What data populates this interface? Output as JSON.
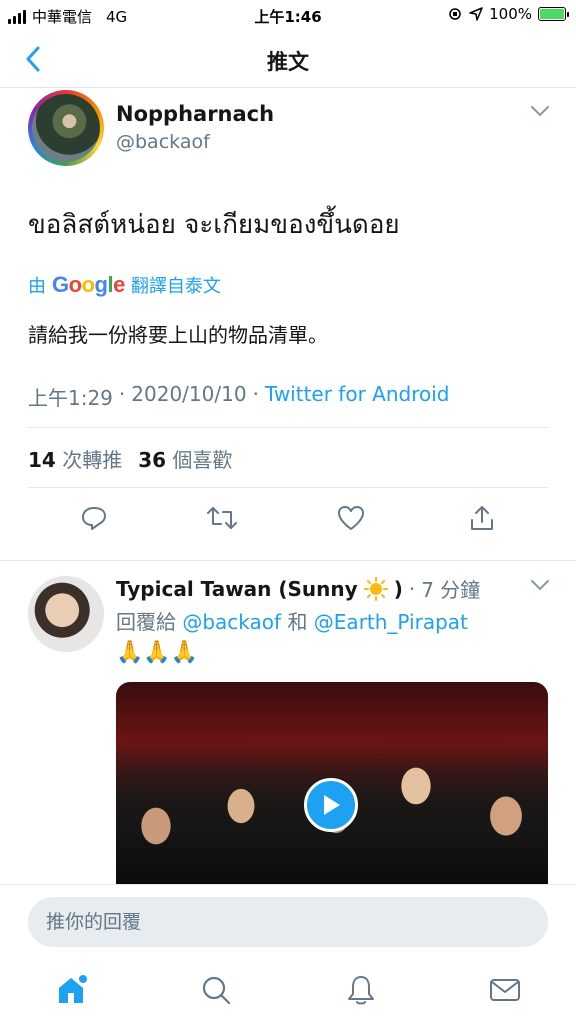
{
  "status_bar": {
    "carrier": "中華電信",
    "network": "4G",
    "time": "上午1:46",
    "battery": "100%"
  },
  "header": {
    "title": "推文"
  },
  "main_tweet": {
    "author_name": "Noppharnach",
    "author_handle": "@backaof",
    "text": "ขอลิสต์หน่อย จะเกียมของขึ้นดอย",
    "translate_prefix": "由",
    "translate_brand": "Google",
    "translate_suffix": "翻譯自泰文",
    "translated_text": "請給我一份將要上山的物品清單。",
    "time": "上午1:29",
    "date": "2020/10/10",
    "source": "Twitter for Android",
    "retweet_count": "14",
    "retweet_label": "次轉推",
    "like_count": "36",
    "like_label": "個喜歡"
  },
  "reply_tweet": {
    "author_name": "Typical Tawan (Sunny",
    "author_name_suffix": ")",
    "time": "7 分鐘",
    "reply_prefix": "回覆給",
    "mention_1": "@backaof",
    "conjunction": "和",
    "mention_2": "@Earth_Pirapat",
    "text": "🙏🙏🙏"
  },
  "composer": {
    "placeholder": "推你的回覆"
  },
  "icons": [
    "back-arrow-icon",
    "chevron-down-icon",
    "reply-icon",
    "retweet-icon",
    "like-icon",
    "share-icon",
    "play-icon",
    "home-icon",
    "search-icon",
    "notifications-icon",
    "messages-icon",
    "sun-icon"
  ],
  "colors": {
    "accent": "#1da1f2",
    "secondary_text": "#657786",
    "divider": "#e1e8ed",
    "input_bg": "#e6ecf0"
  }
}
